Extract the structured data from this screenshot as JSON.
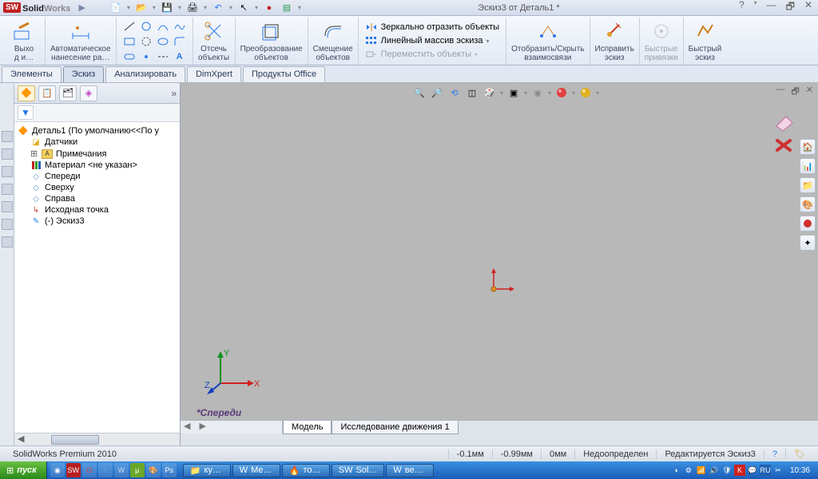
{
  "app": {
    "logo": "SW",
    "name_a": "Solid",
    "name_b": "Works"
  },
  "title": "Эскиз3 от Деталь1 *",
  "qat": [
    "new",
    "open",
    "save",
    "print",
    "undo",
    "select",
    "rebuild",
    "options"
  ],
  "ribbon": {
    "exit": "Выхо\nд и…",
    "smartdim": "Автоматическое\nнанесение ра…",
    "trim": "Отсечь\nобъекты",
    "convert": "Преобразование\nобъектов",
    "offset": "Смещение\nобъектов",
    "mirror": "Зеркально отразить объекты",
    "linear": "Линейный массив эскиза",
    "move": "Переместить объекты",
    "display": "Отобразить/Скрыть\nвзаимосвязи",
    "repair": "Исправить\nэскиз",
    "quicksnap": "Быстрые\nпривязки",
    "rapid": "Быстрый\nэскиз"
  },
  "tabs": [
    "Элементы",
    "Эскиз",
    "Анализировать",
    "DimXpert",
    "Продукты Office"
  ],
  "active_tab": 1,
  "tree": {
    "root": "Деталь1  (По умолчанию<<По у",
    "items": [
      {
        "icon": "sensor",
        "label": "Датчики"
      },
      {
        "icon": "note",
        "label": "Примечания",
        "expand": true
      },
      {
        "icon": "material",
        "label": "Материал <не указан>"
      },
      {
        "icon": "plane",
        "label": "Спереди"
      },
      {
        "icon": "plane",
        "label": "Сверху"
      },
      {
        "icon": "plane",
        "label": "Справа"
      },
      {
        "icon": "origin",
        "label": "Исходная точка"
      },
      {
        "icon": "sketch",
        "label": "(-) Эскиз3"
      }
    ]
  },
  "view_label": "*Спереди",
  "bottom_tabs": [
    "Модель",
    "Исследование движения 1"
  ],
  "status": {
    "product": "SolidWorks Premium 2010",
    "x": "-0.1мм",
    "y": "-0.99мм",
    "z": "0мм",
    "state": "Недоопределен",
    "mode": "Редактируется Эскиз3"
  },
  "taskbar": {
    "start": "пуск",
    "tasks": [
      {
        "i": "📁",
        "t": "ку…"
      },
      {
        "i": "W",
        "t": "Ме…"
      },
      {
        "i": "🔥",
        "t": "то…"
      },
      {
        "i": "SW",
        "t": "Sol…"
      },
      {
        "i": "W",
        "t": "ве…"
      }
    ],
    "clock": "10:36"
  },
  "triad": {
    "x": "X",
    "y": "Y",
    "z": "Z"
  }
}
